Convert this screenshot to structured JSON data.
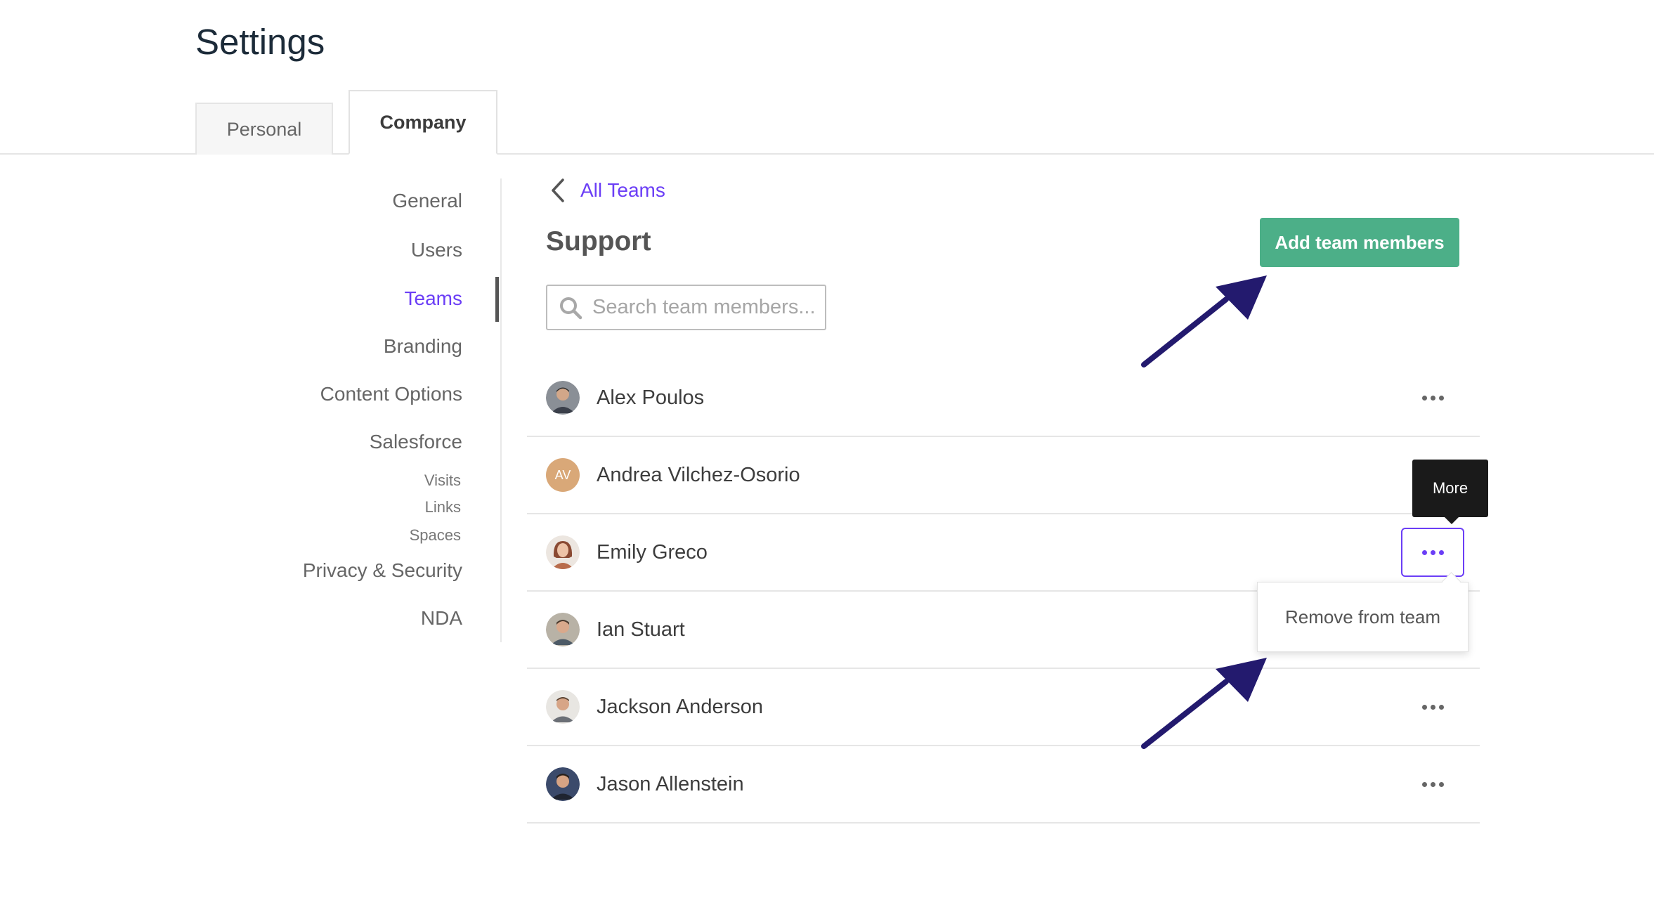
{
  "page": {
    "title": "Settings"
  },
  "tabs": [
    {
      "label": "Personal",
      "active": false
    },
    {
      "label": "Company",
      "active": true
    }
  ],
  "sidebar": {
    "items": [
      {
        "label": "General"
      },
      {
        "label": "Users"
      },
      {
        "label": "Teams",
        "active": true
      },
      {
        "label": "Branding"
      },
      {
        "label": "Content Options"
      },
      {
        "label": "Salesforce"
      },
      {
        "label": "Privacy & Security"
      },
      {
        "label": "NDA"
      }
    ],
    "sub_items": [
      {
        "label": "Visits"
      },
      {
        "label": "Links"
      },
      {
        "label": "Spaces"
      }
    ]
  },
  "main": {
    "back_label": "All Teams",
    "team_name": "Support",
    "add_button_label": "Add team members",
    "search_placeholder": "Search team members..."
  },
  "members": [
    {
      "name": "Alex Poulos",
      "avatar": "photo"
    },
    {
      "name": "Andrea Vilchez-Osorio",
      "avatar": "initials",
      "initials": "AV"
    },
    {
      "name": "Emily Greco",
      "avatar": "photo"
    },
    {
      "name": "Ian Stuart",
      "avatar": "photo"
    },
    {
      "name": "Jackson Anderson",
      "avatar": "photo"
    },
    {
      "name": "Jason Allenstein",
      "avatar": "photo"
    }
  ],
  "tooltip": {
    "label": "More"
  },
  "dropdown": {
    "item_label": "Remove from team"
  },
  "colors": {
    "accent": "#6b3ef6",
    "primary_button": "#4caf88",
    "annotation_arrow": "#231a6e",
    "tooltip_bg": "#1a1a1a"
  }
}
